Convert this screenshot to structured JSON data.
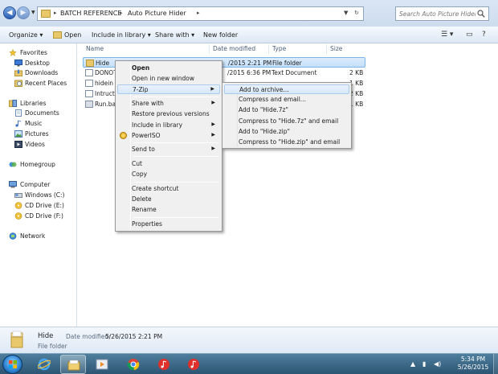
{
  "address": {
    "crumbs": [
      "BATCH REFERENCE",
      "Auto Picture Hider"
    ]
  },
  "search": {
    "placeholder": "Search Auto Picture Hider"
  },
  "toolbar": {
    "organize": "Organize",
    "open": "Open",
    "include_in_library": "Include in library",
    "share_with": "Share with",
    "new_folder": "New folder"
  },
  "nav": {
    "favorites": "Favorites",
    "desktop": "Desktop",
    "downloads": "Downloads",
    "recent_places": "Recent Places",
    "libraries": "Libraries",
    "documents": "Documents",
    "music": "Music",
    "pictures": "Pictures",
    "videos": "Videos",
    "homegroup": "Homegroup",
    "computer": "Computer",
    "windows_c": "Windows (C:)",
    "cd_e": "CD Drive (E:)",
    "cd_f": "CD Drive (F:)",
    "network": "Network"
  },
  "columns": {
    "name": "Name",
    "date_modified": "Date modified",
    "type": "Type",
    "size": "Size"
  },
  "files": [
    {
      "name": "Hide",
      "date": "/2015 2:21 PM",
      "type": "File folder",
      "size": ""
    },
    {
      "name": "DONOT",
      "date": "/2015 6:36 PM",
      "type": "Text Document",
      "size": "2 KB"
    },
    {
      "name": "hidein",
      "date": "",
      "type": "",
      "size": "1 KB"
    },
    {
      "name": "Intructi",
      "date": "",
      "type": "",
      "size": "2 KB"
    },
    {
      "name": "Run.ba",
      "date": "",
      "type": "",
      "size": "1 KB"
    }
  ],
  "context_menu": {
    "open": "Open",
    "open_new_window": "Open in new window",
    "seven_zip": "7-Zip",
    "share_with": "Share with",
    "restore_previous": "Restore previous versions",
    "include_in_library": "Include in library",
    "poweriso": "PowerISO",
    "send_to": "Send to",
    "cut": "Cut",
    "copy": "Copy",
    "create_shortcut": "Create shortcut",
    "delete": "Delete",
    "rename": "Rename",
    "properties": "Properties"
  },
  "submenu": {
    "add_to_archive": "Add to archive...",
    "compress_email": "Compress and email...",
    "add_7z": "Add to \"Hide.7z\"",
    "compress_7z_email": "Compress to \"Hide.7z\" and email",
    "add_zip": "Add to \"Hide.zip\"",
    "compress_zip_email": "Compress to \"Hide.zip\" and email"
  },
  "details": {
    "name": "Hide",
    "date_label": "Date modified:",
    "date_value": "5/26/2015 2:21 PM",
    "type": "File folder"
  },
  "clock": {
    "time": "5:34 PM",
    "date": "5/26/2015"
  },
  "colors": {
    "selection": "#c4e0fb",
    "taskbar": "#2c5573",
    "folder": "#e8c86a"
  }
}
